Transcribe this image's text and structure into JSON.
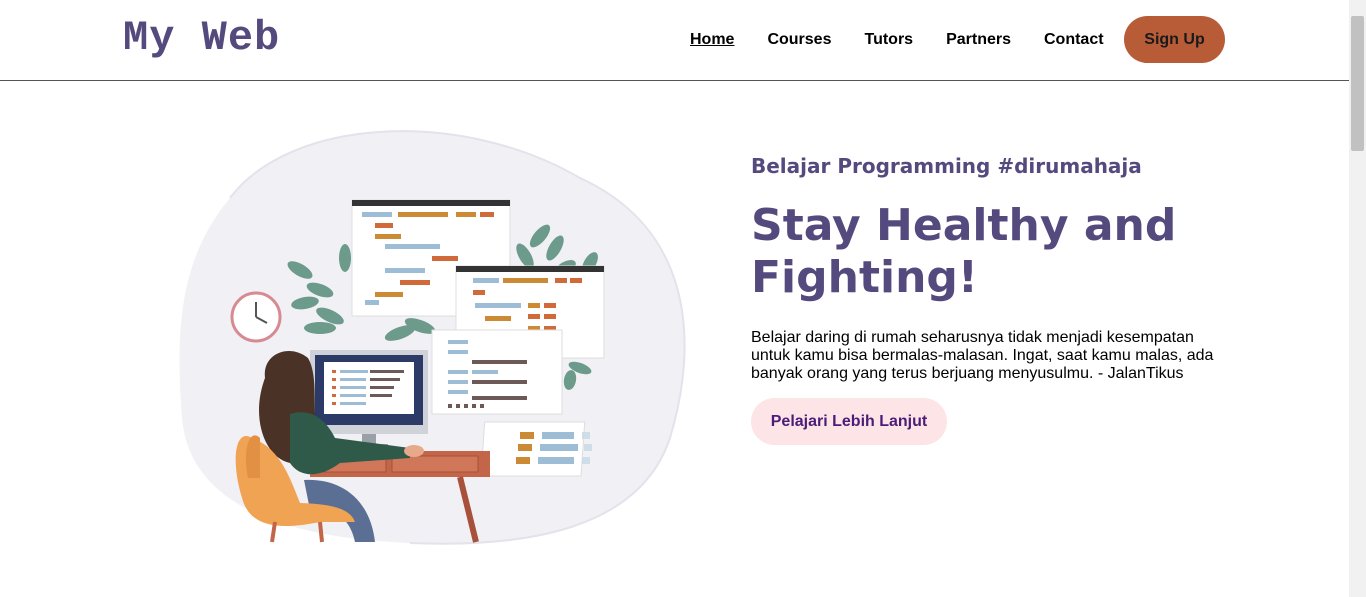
{
  "header": {
    "logo": "My Web",
    "nav": [
      {
        "label": "Home",
        "active": true
      },
      {
        "label": "Courses",
        "active": false
      },
      {
        "label": "Tutors",
        "active": false
      },
      {
        "label": "Partners",
        "active": false
      },
      {
        "label": "Contact",
        "active": false
      }
    ],
    "signup_label": "Sign Up"
  },
  "hero": {
    "tagline": "Belajar Programming #dirumahaja",
    "headline_line1": "Stay Healthy and",
    "headline_line2": "Fighting!",
    "description": "Belajar daring di rumah seharusnya tidak menjadi kesempatan untuk kamu bisa bermalas-malasan. Ingat, saat kamu malas, ada banyak orang yang terus berjuang menyusulmu. - JalanTikus",
    "cta_label": "Pelajari Lebih Lanjut"
  },
  "colors": {
    "brand_purple": "#554a7e",
    "signup_bg": "#b85c38",
    "cta_bg": "#fde4e6",
    "cta_text": "#4b1d78"
  }
}
